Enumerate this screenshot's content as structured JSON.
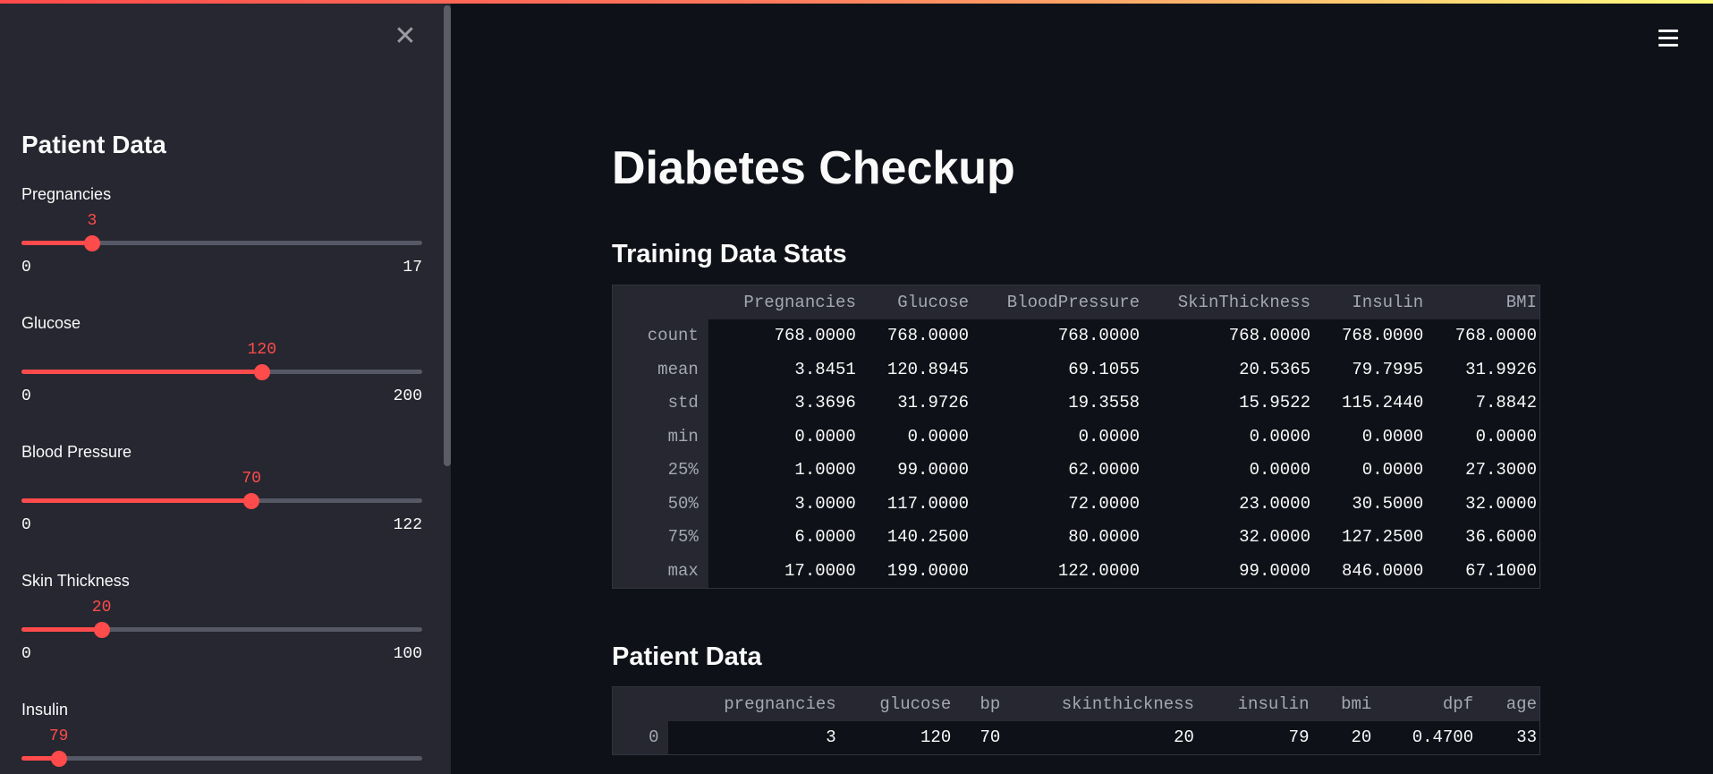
{
  "sidebar": {
    "title": "Patient Data",
    "sliders": [
      {
        "label": "Pregnancies",
        "value": "3",
        "min": "0",
        "max": "17",
        "fraction": 0.176
      },
      {
        "label": "Glucose",
        "value": "120",
        "min": "0",
        "max": "200",
        "fraction": 0.6
      },
      {
        "label": "Blood Pressure",
        "value": "70",
        "min": "0",
        "max": "122",
        "fraction": 0.574
      },
      {
        "label": "Skin Thickness",
        "value": "20",
        "min": "0",
        "max": "100",
        "fraction": 0.2
      },
      {
        "label": "Insulin",
        "value": "79",
        "min": "",
        "max": "",
        "fraction": 0.093
      }
    ]
  },
  "main": {
    "title": "Diabetes Checkup",
    "stats_title": "Training Data Stats",
    "patient_title": "Patient Data"
  },
  "stats_table": {
    "columns": [
      "Pregnancies",
      "Glucose",
      "BloodPressure",
      "SkinThickness",
      "Insulin",
      "BMI"
    ],
    "rows": [
      {
        "index": "count",
        "cells": [
          "768.0000",
          "768.0000",
          "768.0000",
          "768.0000",
          "768.0000",
          "768.0000"
        ]
      },
      {
        "index": "mean",
        "cells": [
          "3.8451",
          "120.8945",
          "69.1055",
          "20.5365",
          "79.7995",
          "31.9926"
        ]
      },
      {
        "index": "std",
        "cells": [
          "3.3696",
          "31.9726",
          "19.3558",
          "15.9522",
          "115.2440",
          "7.8842"
        ]
      },
      {
        "index": "min",
        "cells": [
          "0.0000",
          "0.0000",
          "0.0000",
          "0.0000",
          "0.0000",
          "0.0000"
        ]
      },
      {
        "index": "25%",
        "cells": [
          "1.0000",
          "99.0000",
          "62.0000",
          "0.0000",
          "0.0000",
          "27.3000"
        ]
      },
      {
        "index": "50%",
        "cells": [
          "3.0000",
          "117.0000",
          "72.0000",
          "23.0000",
          "30.5000",
          "32.0000"
        ]
      },
      {
        "index": "75%",
        "cells": [
          "6.0000",
          "140.2500",
          "80.0000",
          "32.0000",
          "127.2500",
          "36.6000"
        ]
      },
      {
        "index": "max",
        "cells": [
          "17.0000",
          "199.0000",
          "122.0000",
          "99.0000",
          "846.0000",
          "67.1000"
        ]
      }
    ]
  },
  "patient_table": {
    "columns": [
      "pregnancies",
      "glucose",
      "bp",
      "skinthickness",
      "insulin",
      "bmi",
      "dpf",
      "age"
    ],
    "rows": [
      {
        "index": "0",
        "cells": [
          "3",
          "120",
          "70",
          "20",
          "79",
          "20",
          "0.4700",
          "33"
        ]
      }
    ]
  },
  "colors": {
    "accent": "#ff4b4b",
    "sidebar_bg": "#262730",
    "main_bg": "#0e1117"
  },
  "icons": {
    "close": "close-icon",
    "menu": "hamburger-menu-icon"
  }
}
